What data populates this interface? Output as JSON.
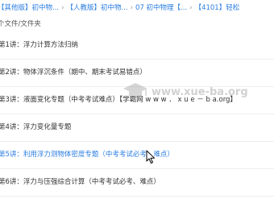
{
  "breadcrumb": {
    "items": [
      "【其他版】初中物...",
      "【人教版】初中物...",
      "07 初中物理【...",
      "【4101】轻松"
    ],
    "separator": "›"
  },
  "subheader": "个文件/文件夹",
  "files": [
    {
      "name": "第1讲：浮力计算方法归纳"
    },
    {
      "name": "第2讲：物体浮沉条件（期中、期末考试易错点）"
    },
    {
      "name": "第3讲：液面变化专题（中考考试难点）【学霸网 w w w ． x u e － b a.org】"
    },
    {
      "name": "第4讲：浮力变化量专题"
    },
    {
      "name": "第5讲：利用浮力测物体密度专题（中考考试必考、难点）",
      "active": true
    },
    {
      "name": "第6讲：浮力与压强综合计算（中考考试必考、难点）"
    }
  ],
  "watermark": "www.xue-ba.org",
  "colors": {
    "link": "#2a7de1",
    "text": "#333333",
    "divider": "#eeeeee"
  }
}
